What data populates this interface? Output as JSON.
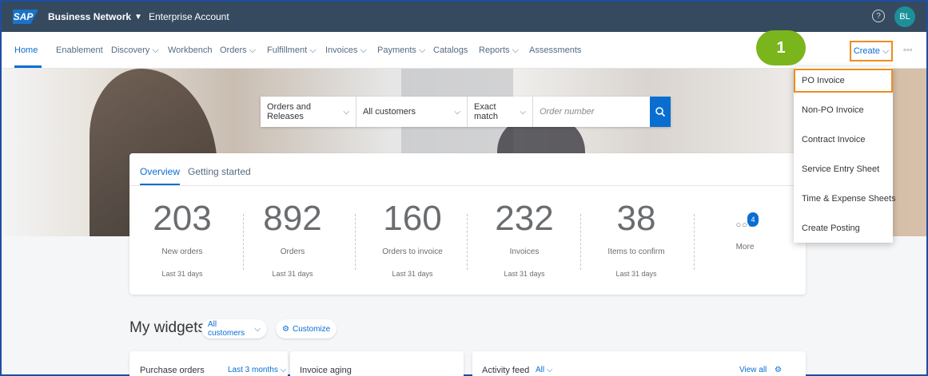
{
  "topbar": {
    "logo": "SAP",
    "brand": "Business Network",
    "account": "Enterprise Account",
    "help_glyph": "?",
    "avatar_initials": "BL"
  },
  "nav": {
    "items": [
      "Home",
      "Enablement",
      "Discovery",
      "Workbench",
      "Orders",
      "Fulfillment",
      "Invoices",
      "Payments",
      "Catalogs",
      "Reports",
      "Assessments"
    ],
    "create_label": "Create",
    "more_glyph": "◦◦◦"
  },
  "step_badge": "1",
  "search": {
    "scope": "Orders and Releases",
    "customers": "All customers",
    "match": "Exact match",
    "placeholder": "Order number"
  },
  "overview": {
    "tabs": [
      "Overview",
      "Getting started"
    ],
    "tiles": [
      {
        "value": "203",
        "label": "New orders",
        "sub": "Last 31 days"
      },
      {
        "value": "892",
        "label": "Orders",
        "sub": "Last 31 days"
      },
      {
        "value": "160",
        "label": "Orders to invoice",
        "sub": "Last 31 days"
      },
      {
        "value": "232",
        "label": "Invoices",
        "sub": "Last 31 days"
      },
      {
        "value": "38",
        "label": "Items to confirm",
        "sub": "Last 31 days"
      }
    ],
    "more_count": "4",
    "more_label": "More"
  },
  "widgets": {
    "title": "My widgets",
    "customers_pill": "All customers",
    "customize_pill": "Customize",
    "cards": {
      "purchase_orders": "Purchase orders",
      "purchase_orders_range": "Last 3 months",
      "invoice_aging": "Invoice aging",
      "activity_feed": "Activity feed",
      "activity_filter": "All",
      "view_all": "View all"
    }
  },
  "create_menu": {
    "items": [
      "PO Invoice",
      "Non-PO Invoice",
      "Contract Invoice",
      "Service Entry Sheet",
      "Time & Expense Sheets",
      "Create Posting"
    ]
  },
  "colors": {
    "shell": "#354a5f",
    "accent": "#0a6ed1",
    "highlight": "#f08c1e",
    "step_badge": "#7ab51d"
  }
}
